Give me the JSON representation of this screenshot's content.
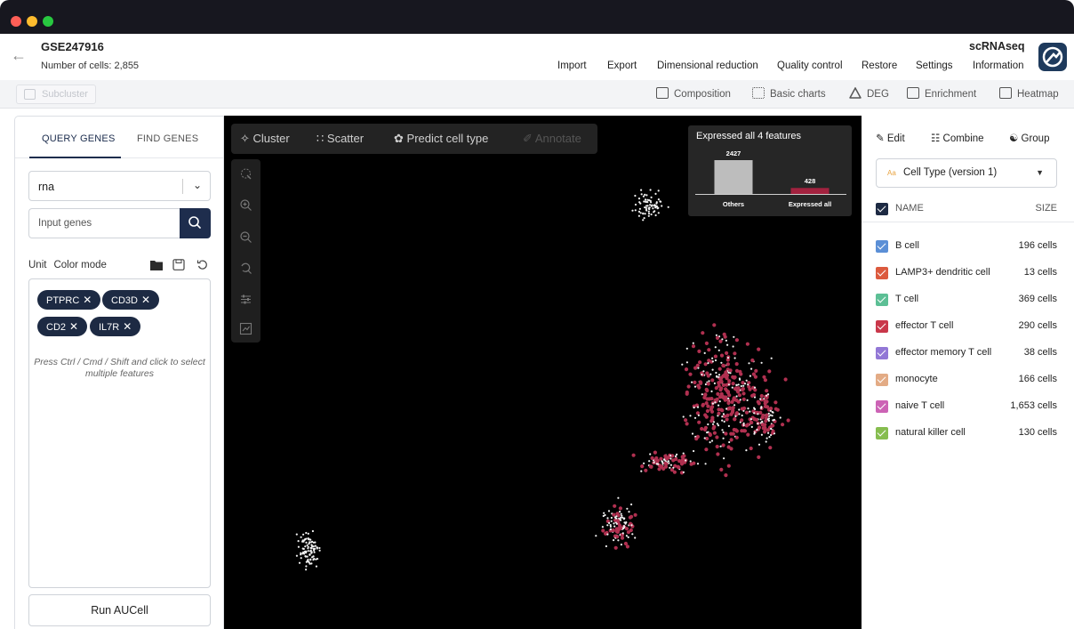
{
  "window": {
    "dot_colors": [
      "#ff5f57",
      "#febc2e",
      "#28c840"
    ]
  },
  "header": {
    "dataset_title": "GSE247916",
    "cell_count": "Number of cells: 2,855",
    "menu": [
      "Import",
      "Export",
      "Dimensional reduction",
      "Quality control",
      "Restore",
      "Settings",
      "Information"
    ],
    "brand": "scRNAseq"
  },
  "toolbar": {
    "subcluster_label": "Subcluster",
    "buttons": [
      "Composition",
      "Basic charts",
      "DEG",
      "Enrichment",
      "Heatmap"
    ]
  },
  "left_panel": {
    "tabs": [
      "QUERY GENES",
      "FIND GENES"
    ],
    "active_tab": "QUERY GENES",
    "assay_select": "rna",
    "gene_input_placeholder": "Input genes",
    "unit_label": "Unit",
    "color_mode_label": "Color mode",
    "genes": [
      "PTPRC",
      "CD3D",
      "CD2",
      "IL7R"
    ],
    "hint": "Press Ctrl / Cmd / Shift and click to select multiple features",
    "run_button": "Run AUCell"
  },
  "plot": {
    "tools": [
      "Cluster",
      "Scatter",
      "Predict cell type",
      "Annotate"
    ],
    "vertical_tools": [
      "lasso-select-icon",
      "zoom-in-icon",
      "zoom-out-icon",
      "zoom-reset-icon",
      "adjust-icon",
      "export-icon"
    ],
    "point_colors": {
      "others": "#f2f2f2",
      "expressed": "#b03050"
    }
  },
  "chart_data": {
    "type": "bar",
    "title": "Expressed all 4 features",
    "categories": [
      "Others",
      "Expressed all"
    ],
    "values": [
      2427,
      428
    ],
    "colors": [
      "#bdbdbd",
      "#a3223f"
    ],
    "ylim": [
      0,
      2427
    ]
  },
  "right_panel": {
    "actions": [
      "Edit",
      "Combine",
      "Group"
    ],
    "annotation_select": "Cell Type (version 1)",
    "col_name": "NAME",
    "col_size": "SIZE",
    "cell_types": [
      {
        "name": "B cell",
        "size": "196 cells",
        "color": "#5b8fd6"
      },
      {
        "name": "LAMP3+ dendritic cell",
        "size": "13 cells",
        "color": "#dc5a3e"
      },
      {
        "name": "T cell",
        "size": "369 cells",
        "color": "#5cbf95"
      },
      {
        "name": "effector T cell",
        "size": "290 cells",
        "color": "#c9374a"
      },
      {
        "name": "effector memory T cell",
        "size": "38 cells",
        "color": "#9277d6"
      },
      {
        "name": "monocyte",
        "size": "166 cells",
        "color": "#e3ab85"
      },
      {
        "name": "naive T cell",
        "size": "1,653 cells",
        "color": "#cc63b5"
      },
      {
        "name": "natural killer cell",
        "size": "130 cells",
        "color": "#86bd4f"
      }
    ]
  }
}
